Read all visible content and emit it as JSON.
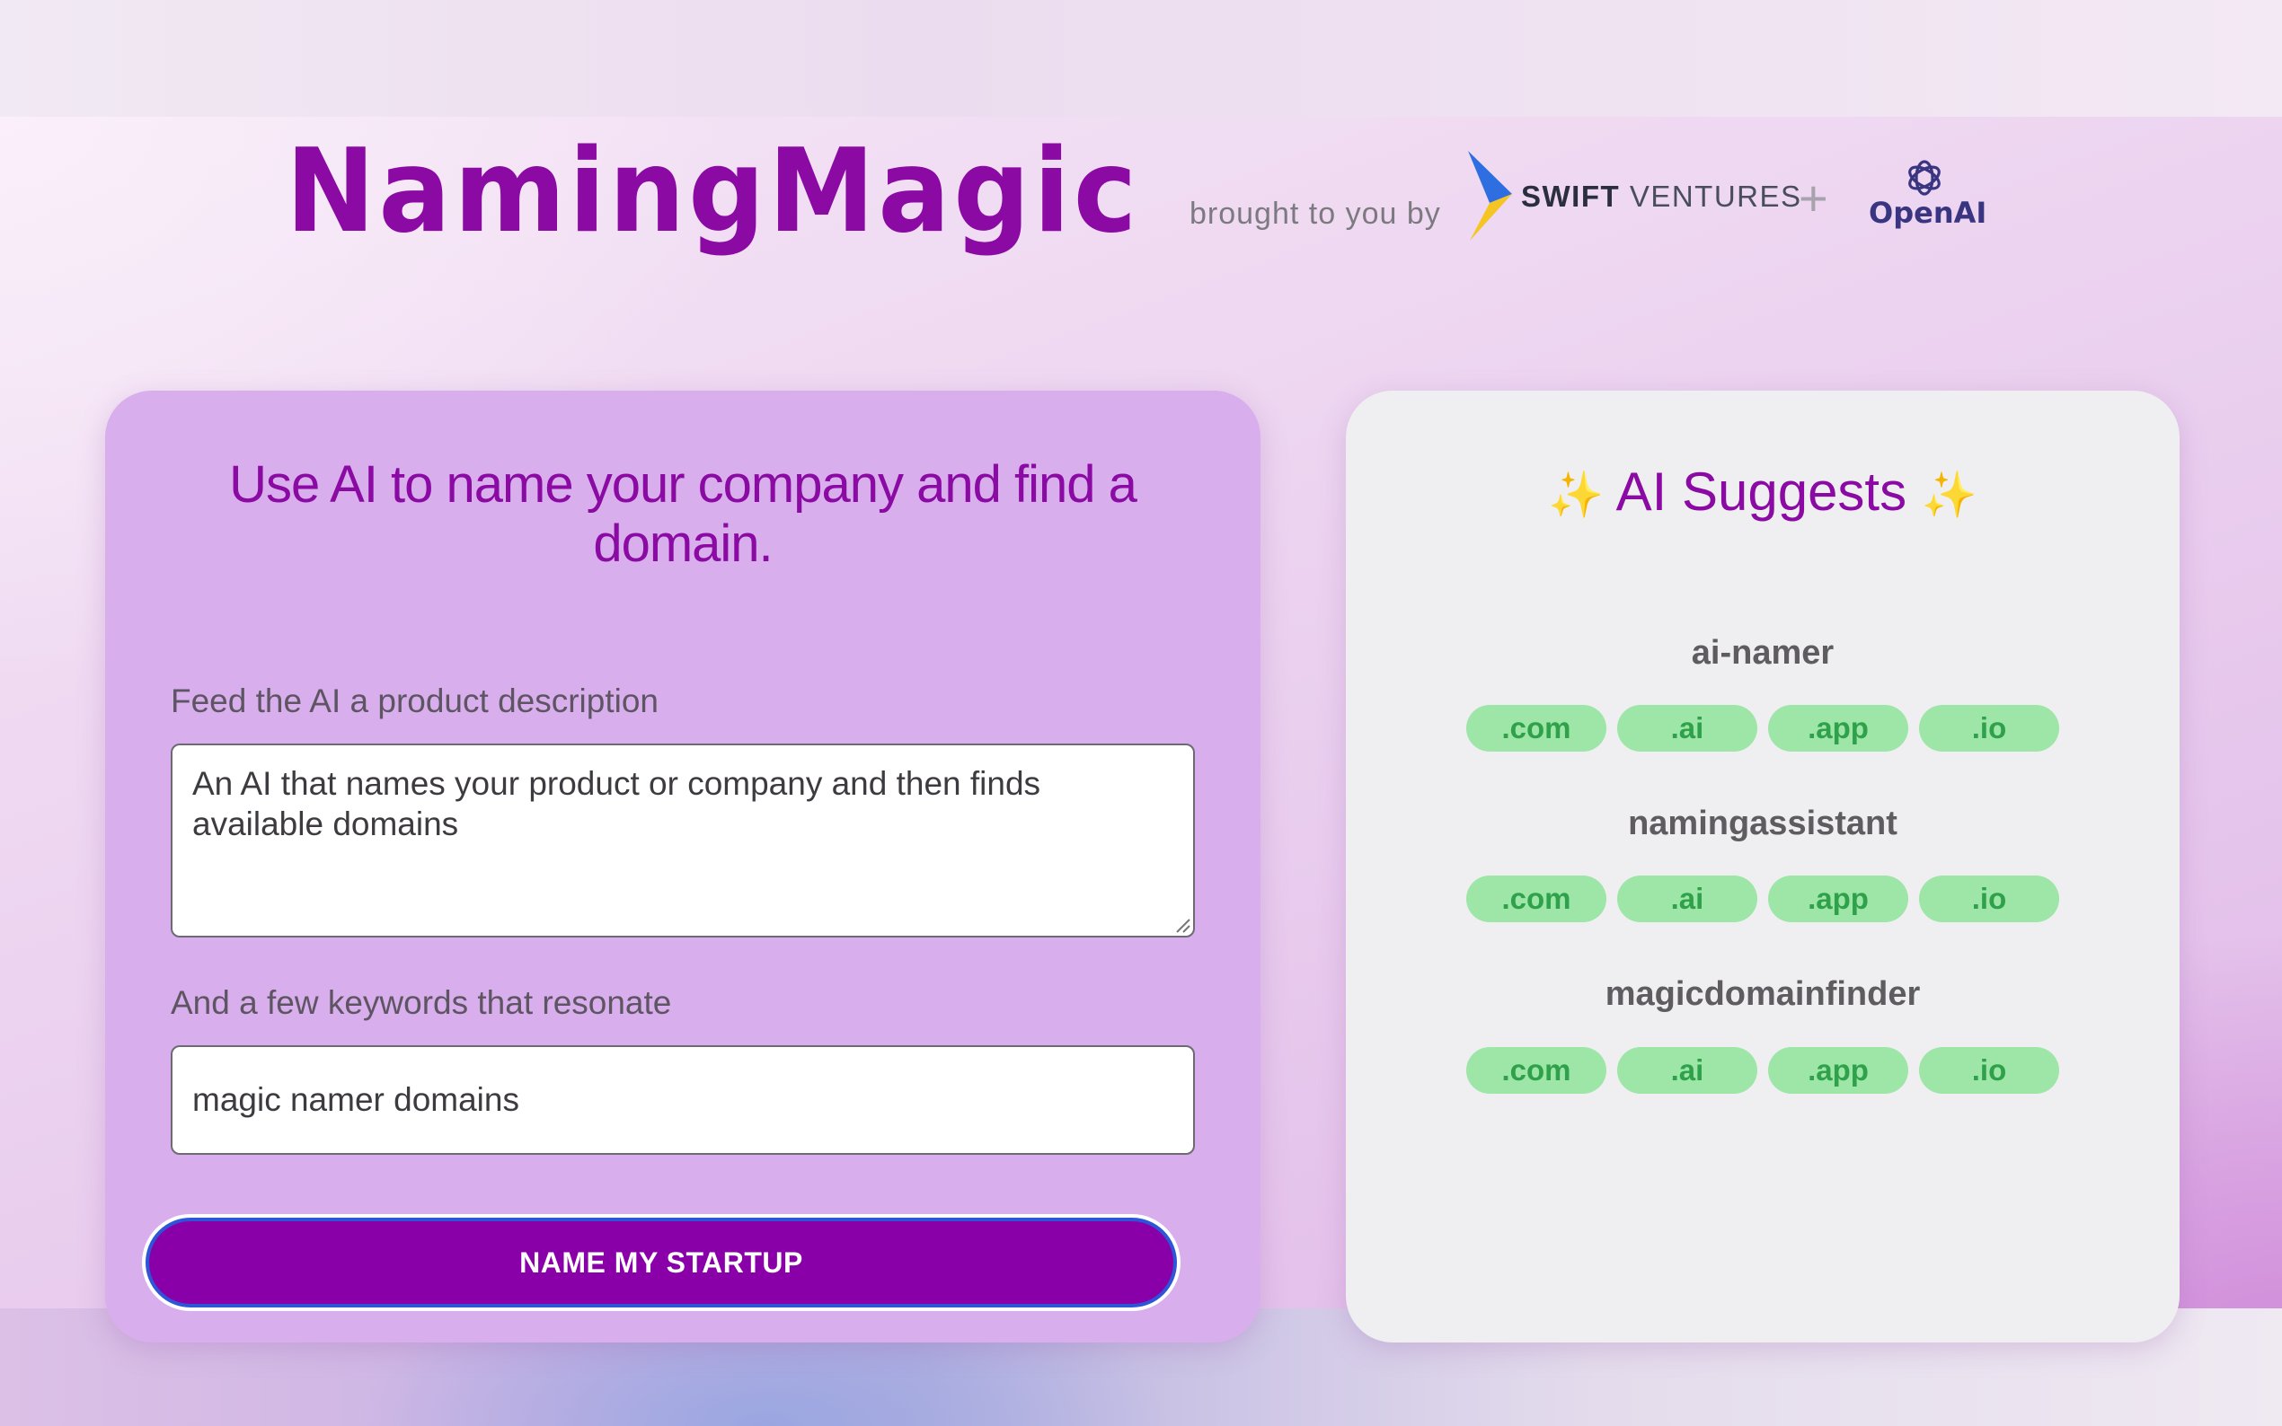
{
  "header": {
    "brand": "NamingMagic",
    "byline": "brought to you by",
    "partners": {
      "swift_bold": "SWIFT",
      "swift_rest": " VENTURES",
      "plus": "+",
      "openai": "OpenAI"
    }
  },
  "form": {
    "heading": "Use AI to name your company and find a domain.",
    "description_label": "Feed the AI a product description",
    "description_value": "An AI that names your product or company and then finds available domains",
    "keywords_label": "And a few keywords that resonate",
    "keywords_value": "magic namer domains",
    "submit_label": "NAME MY STARTUP"
  },
  "suggestions": {
    "heading": "AI Suggests",
    "sparkle": "✨",
    "items": [
      {
        "name": "ai-namer",
        "tlds": [
          ".com",
          ".ai",
          ".app",
          ".io"
        ]
      },
      {
        "name": "namingassistant",
        "tlds": [
          ".com",
          ".ai",
          ".app",
          ".io"
        ]
      },
      {
        "name": "magicdomainfinder",
        "tlds": [
          ".com",
          ".ai",
          ".app",
          ".io"
        ]
      }
    ]
  },
  "colors": {
    "brand_purple": "#8a0aa3",
    "chip_green": "#9ee6a8",
    "chip_text": "#2ea14a",
    "button_purple": "#8a00a8"
  }
}
